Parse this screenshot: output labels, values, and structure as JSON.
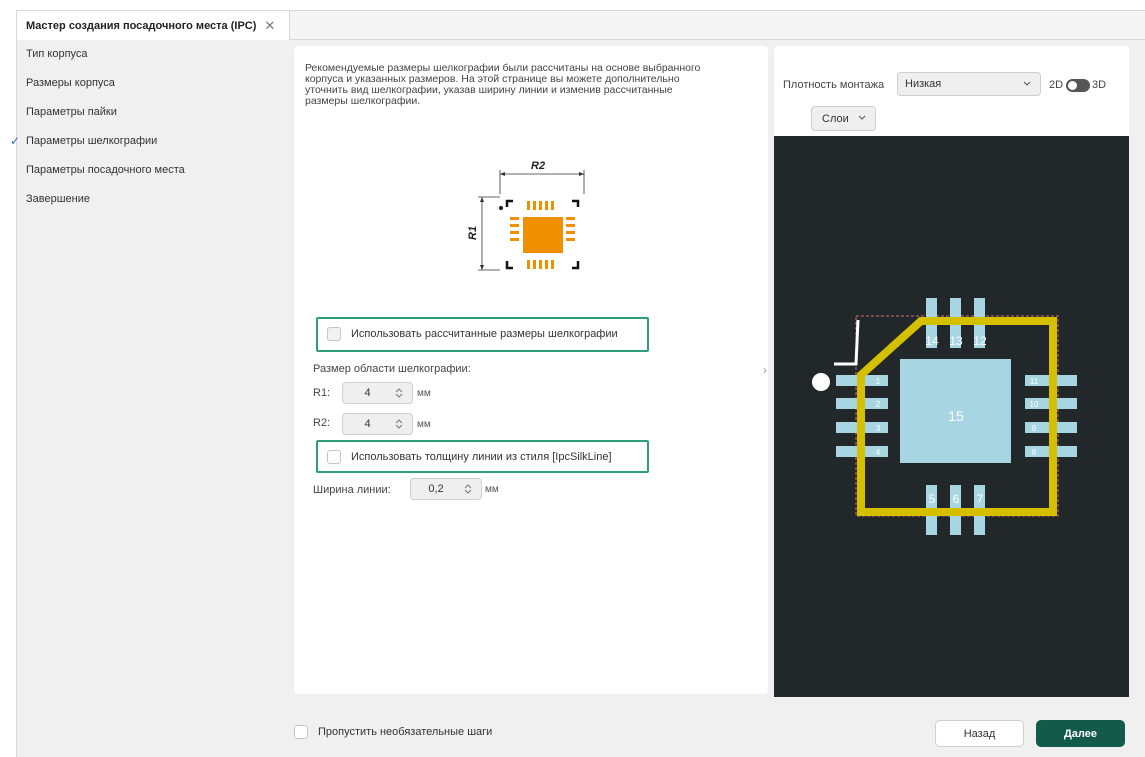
{
  "tab": {
    "title": "Мастер создания посадочного места (IPC)",
    "close_icon": "close-icon"
  },
  "nav": {
    "items": [
      {
        "label": "Тип корпуса",
        "checked": false
      },
      {
        "label": "Размеры корпуса",
        "checked": false
      },
      {
        "label": "Параметры пайки",
        "checked": false
      },
      {
        "label": "Параметры шелкографии",
        "checked": true
      },
      {
        "label": "Параметры посадочного места",
        "checked": false
      },
      {
        "label": "Завершение",
        "checked": false
      }
    ],
    "check_mark": "✓"
  },
  "main": {
    "description_lines": [
      "Рекомендуемые размеры шелкографии были рассчитаны на основе выбранного",
      "корпуса и указанных размеров. На этой странице вы можете дополнительно",
      "уточнить вид шелкографии, указав ширину линии и изменив рассчитанные",
      "размеры шелкографии."
    ],
    "diagram": {
      "label_r2": "R2",
      "label_r1": "R1"
    },
    "use_calculated_label": "Использовать рассчитанные размеры шелкографии",
    "area_size_label": "Размер области шелкографии:",
    "r1": {
      "label": "R1:",
      "value": "4",
      "unit": "мм"
    },
    "r2": {
      "label": "R2:",
      "value": "4",
      "unit": "мм"
    },
    "use_style_thickness_label": "Использовать толщину линии из стиля [IpcSilkLine]",
    "line_width": {
      "label": "Ширина линии:",
      "value": "0,2",
      "unit": "мм"
    }
  },
  "preview": {
    "density_label": "Плотность монтажа",
    "density_value": "Низкая",
    "mode_2d": "2D",
    "mode_3d": "3D",
    "layers_label": "Слои",
    "pads_left": [
      "1",
      "2",
      "3",
      "4"
    ],
    "pads_bottom": [
      "5",
      "6",
      "7"
    ],
    "pads_right": [
      "8",
      "9",
      "10",
      "11"
    ],
    "pads_top": [
      "12",
      "13",
      "14"
    ],
    "center_pad": "15"
  },
  "footer": {
    "skip_label": "Пропустить необязательные шаги",
    "back_label": "Назад",
    "next_label": "Далее"
  },
  "colors": {
    "accent": "#135a4b",
    "highlight": "#2f9e7d",
    "pad": "#a7d6e2",
    "silk": "#d4c000",
    "canvas": "#222829",
    "diagram_orange": "#f09000"
  }
}
